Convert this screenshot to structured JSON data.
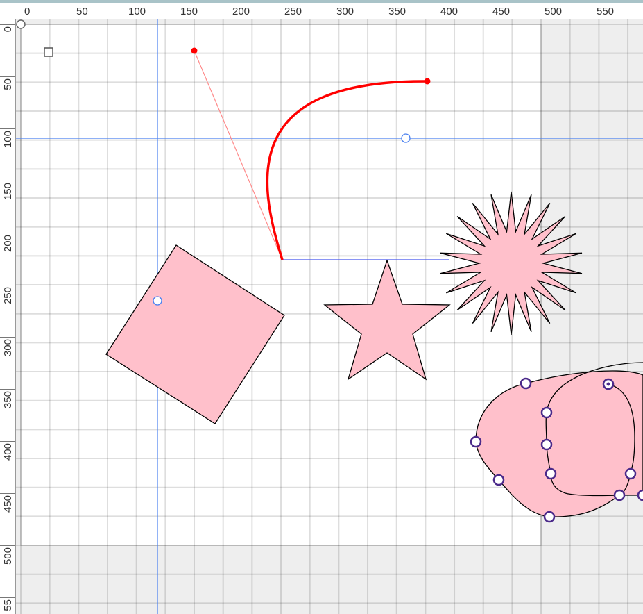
{
  "ruler_top": {
    "labels": [
      "0",
      "50",
      "100",
      "150",
      "200",
      "250",
      "300",
      "350",
      "400",
      "450",
      "500",
      "550"
    ]
  },
  "ruler_left": {
    "labels": [
      "0",
      "50",
      "100",
      "150",
      "200",
      "250",
      "300",
      "350",
      "400",
      "450",
      "500",
      "55"
    ]
  },
  "colors": {
    "fill": "#ffc0cb",
    "stroke": "#000000",
    "curve": "#ff0000",
    "guide": "#4a80f0",
    "handle": "#4b2a8a"
  },
  "shapes": [
    "rotated-square",
    "star",
    "starburst",
    "path-blob",
    "bezier-curve"
  ]
}
